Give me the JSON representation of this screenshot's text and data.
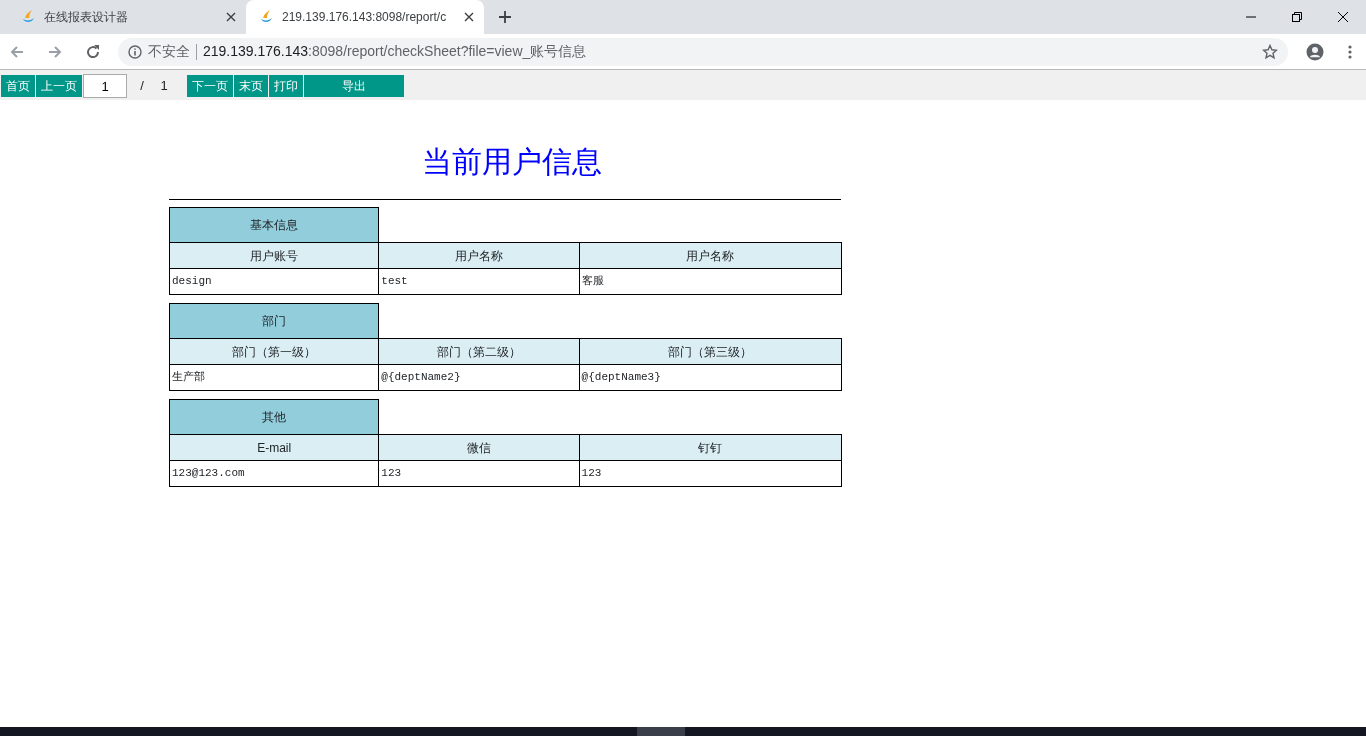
{
  "browser": {
    "tabs": [
      {
        "title": "在线报表设计器",
        "selected": false
      },
      {
        "title": "219.139.176.143:8098/report/c",
        "selected": true
      }
    ],
    "address": {
      "security_label": "不安全",
      "host": "219.139.176.143",
      "rest": ":8098/report/checkSheet?file=view_账号信息"
    }
  },
  "toolbar": [
    {
      "kind": "button",
      "label": "首页"
    },
    {
      "kind": "button",
      "label": "上一页"
    },
    {
      "kind": "input",
      "value": "1"
    },
    {
      "kind": "text",
      "label": "/"
    },
    {
      "kind": "text",
      "label": "1"
    },
    {
      "kind": "button",
      "label": "下一页"
    },
    {
      "kind": "button",
      "label": "末页"
    },
    {
      "kind": "button",
      "label": "打印"
    },
    {
      "kind": "wide",
      "label": "导出"
    }
  ],
  "report": {
    "title": "当前用户信息",
    "sections": [
      {
        "heading": "基本信息",
        "columns": [
          "用户账号",
          "用户名称",
          "用户名称"
        ],
        "rows": [
          [
            "design",
            "test",
            "客服"
          ]
        ]
      },
      {
        "heading": "部门",
        "columns": [
          "部门（第一级）",
          "部门（第二级）",
          "部门（第三级）"
        ],
        "rows": [
          [
            "生产部",
            "@{deptName2}",
            "@{deptName3}"
          ]
        ]
      },
      {
        "heading": "其他",
        "columns": [
          "E-mail",
          "微信",
          "钉钉"
        ],
        "rows": [
          [
            "123@123.com",
            "123",
            "123"
          ]
        ]
      }
    ]
  }
}
